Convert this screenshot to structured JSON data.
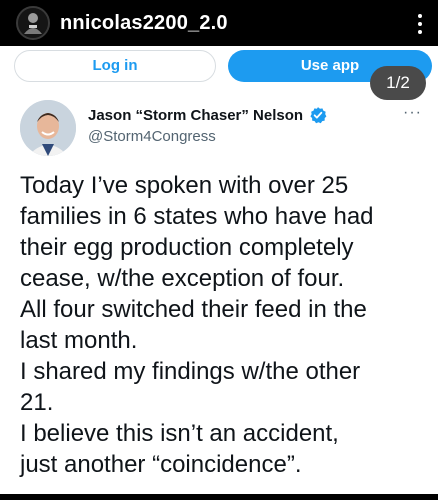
{
  "instagram": {
    "username": "nnicolas2200_2.0",
    "page_indicator": "1/2"
  },
  "post": {
    "login_label": "Log in",
    "use_app_label": "Use app",
    "author_name": "Jason “Storm Chaser” Nelson",
    "author_handle": "@Storm4Congress",
    "more_label": "···",
    "text": "Today I’ve spoken with over 25\nfamilies in 6 states who have had\ntheir egg production completely\ncease, w/the exception of four.\nAll four switched their feed in the\nlast month.\nI shared my findings w/the other\n21.\nI believe this isn’t an accident,\njust another “coincidence”."
  },
  "colors": {
    "accent": "#1d9bf0",
    "topbar": "#000000",
    "text": "#0f1419",
    "secondary": "#536471"
  },
  "icons": [
    "profile-avatar-icon",
    "kebab-menu-icon",
    "verified-badge-icon",
    "more-options-icon"
  ]
}
